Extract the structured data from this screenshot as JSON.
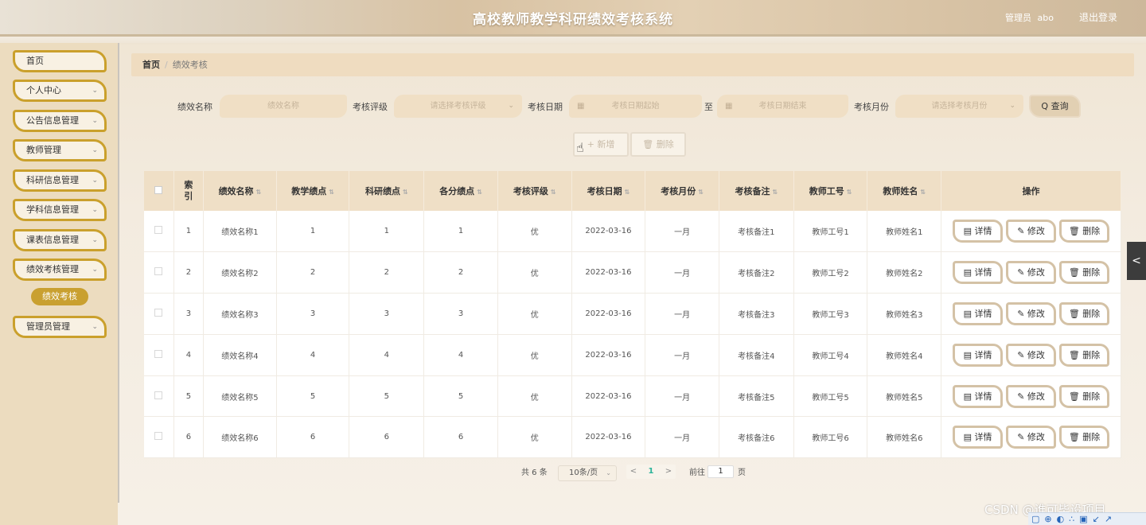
{
  "header": {
    "title": "高校教师教学科研绩效考核系统",
    "user_role": "管理员",
    "user_name": "abo",
    "logout": "退出登录"
  },
  "sidebar": {
    "items": [
      {
        "label": "首页",
        "chevron": ""
      },
      {
        "label": "个人中心",
        "chevron": "⌄"
      },
      {
        "label": "公告信息管理",
        "chevron": "⌄"
      },
      {
        "label": "教师管理",
        "chevron": "⌄"
      },
      {
        "label": "科研信息管理",
        "chevron": "⌄"
      },
      {
        "label": "学科信息管理",
        "chevron": "⌄"
      },
      {
        "label": "课表信息管理",
        "chevron": "⌄"
      },
      {
        "label": "绩效考核管理",
        "chevron": "⌄"
      },
      {
        "label": "管理员管理",
        "chevron": "⌄"
      }
    ],
    "active_sub": "绩效考核"
  },
  "breadcrumb": {
    "home": "首页",
    "sep": "/",
    "current": "绩效考核"
  },
  "search": {
    "name_label": "绩效名称",
    "name_placeholder": "绩效名称",
    "grade_label": "考核评级",
    "grade_placeholder": "请选择考核评级",
    "date_label": "考核日期",
    "date_start_placeholder": "考核日期起始",
    "to": "至",
    "date_end_placeholder": "考核日期结束",
    "month_label": "考核月份",
    "month_placeholder": "请选择考核月份",
    "query": "Q 查询"
  },
  "actions": {
    "add": "+ 新增",
    "delete": "删除"
  },
  "table": {
    "headers": [
      "索引",
      "绩效名称",
      "教学绩点",
      "科研绩点",
      "各分绩点",
      "考核评级",
      "考核日期",
      "考核月份",
      "考核备注",
      "教师工号",
      "教师姓名",
      "操作"
    ],
    "sort_icon": "⇅",
    "rows": [
      {
        "index": "1",
        "name": "绩效名称1",
        "teach": "1",
        "research": "1",
        "sub": "1",
        "grade": "优",
        "date": "2022-03-16",
        "month": "一月",
        "remark": "考核备注1",
        "no": "教师工号1",
        "teacher": "教师姓名1"
      },
      {
        "index": "2",
        "name": "绩效名称2",
        "teach": "2",
        "research": "2",
        "sub": "2",
        "grade": "优",
        "date": "2022-03-16",
        "month": "一月",
        "remark": "考核备注2",
        "no": "教师工号2",
        "teacher": "教师姓名2"
      },
      {
        "index": "3",
        "name": "绩效名称3",
        "teach": "3",
        "research": "3",
        "sub": "3",
        "grade": "优",
        "date": "2022-03-16",
        "month": "一月",
        "remark": "考核备注3",
        "no": "教师工号3",
        "teacher": "教师姓名3"
      },
      {
        "index": "4",
        "name": "绩效名称4",
        "teach": "4",
        "research": "4",
        "sub": "4",
        "grade": "优",
        "date": "2022-03-16",
        "month": "一月",
        "remark": "考核备注4",
        "no": "教师工号4",
        "teacher": "教师姓名4"
      },
      {
        "index": "5",
        "name": "绩效名称5",
        "teach": "5",
        "research": "5",
        "sub": "5",
        "grade": "优",
        "date": "2022-03-16",
        "month": "一月",
        "remark": "考核备注5",
        "no": "教师工号5",
        "teacher": "教师姓名5"
      },
      {
        "index": "6",
        "name": "绩效名称6",
        "teach": "6",
        "research": "6",
        "sub": "6",
        "grade": "优",
        "date": "2022-03-16",
        "month": "一月",
        "remark": "考核备注6",
        "no": "教师工号6",
        "teacher": "教师姓名6"
      }
    ],
    "ops": {
      "detail": "▤ 详情",
      "edit": "✎ 修改",
      "delete": "🗑 删除"
    }
  },
  "pagination": {
    "total_text": "共 6 条",
    "page_size": "10条/页",
    "prev": "<",
    "current_page": "1",
    "next": ">",
    "goto_label": "前往",
    "goto_value": "1",
    "page_suffix": "页"
  },
  "side_toggle": "<",
  "watermark": "CSDN @谁可毕设项目"
}
